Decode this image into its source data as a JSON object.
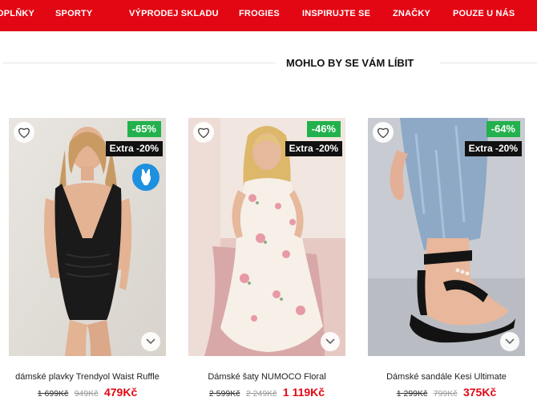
{
  "nav": {
    "items": [
      {
        "label": "OPLŇKY"
      },
      {
        "label": "SPORTY"
      },
      {
        "label": "VÝPRODEJ SKLADU"
      },
      {
        "label": "FROGIES"
      },
      {
        "label": "INSPIRUJTE SE"
      },
      {
        "label": "ZNAČKY"
      },
      {
        "label": "POUZE U NÁS"
      }
    ]
  },
  "section": {
    "title": "MOHLO BY SE VÁM LÍBIT"
  },
  "products": [
    {
      "name": "dámské plavky Trendyol Waist Ruffle",
      "discount": "-65%",
      "extra": "Extra -20%",
      "price_original": "1 699Kč",
      "price_before": "949Kč",
      "price_current": "479Kč",
      "icons": [
        "heart-icon",
        "swimsuit-icon",
        "chevron-down-icon"
      ]
    },
    {
      "name": "Dámské šaty NUMOCO Floral",
      "discount": "-46%",
      "extra": "Extra -20%",
      "price_original": "2 599Kč",
      "price_before": "2 249Kč",
      "price_current": "1 119Kč",
      "icons": [
        "heart-icon",
        "chevron-down-icon"
      ]
    },
    {
      "name": "Dámské sandále Kesi Ultimate",
      "discount": "-64%",
      "extra": "Extra -20%",
      "price_original": "1 299Kč",
      "price_before": "799Kč",
      "price_current": "375Kč",
      "icons": [
        "heart-icon",
        "chevron-down-icon"
      ]
    }
  ],
  "colors": {
    "brand_red": "#e30613",
    "discount_green": "#22b14c",
    "extra_black": "#111111",
    "swim_badge_blue": "#1e90e0"
  }
}
